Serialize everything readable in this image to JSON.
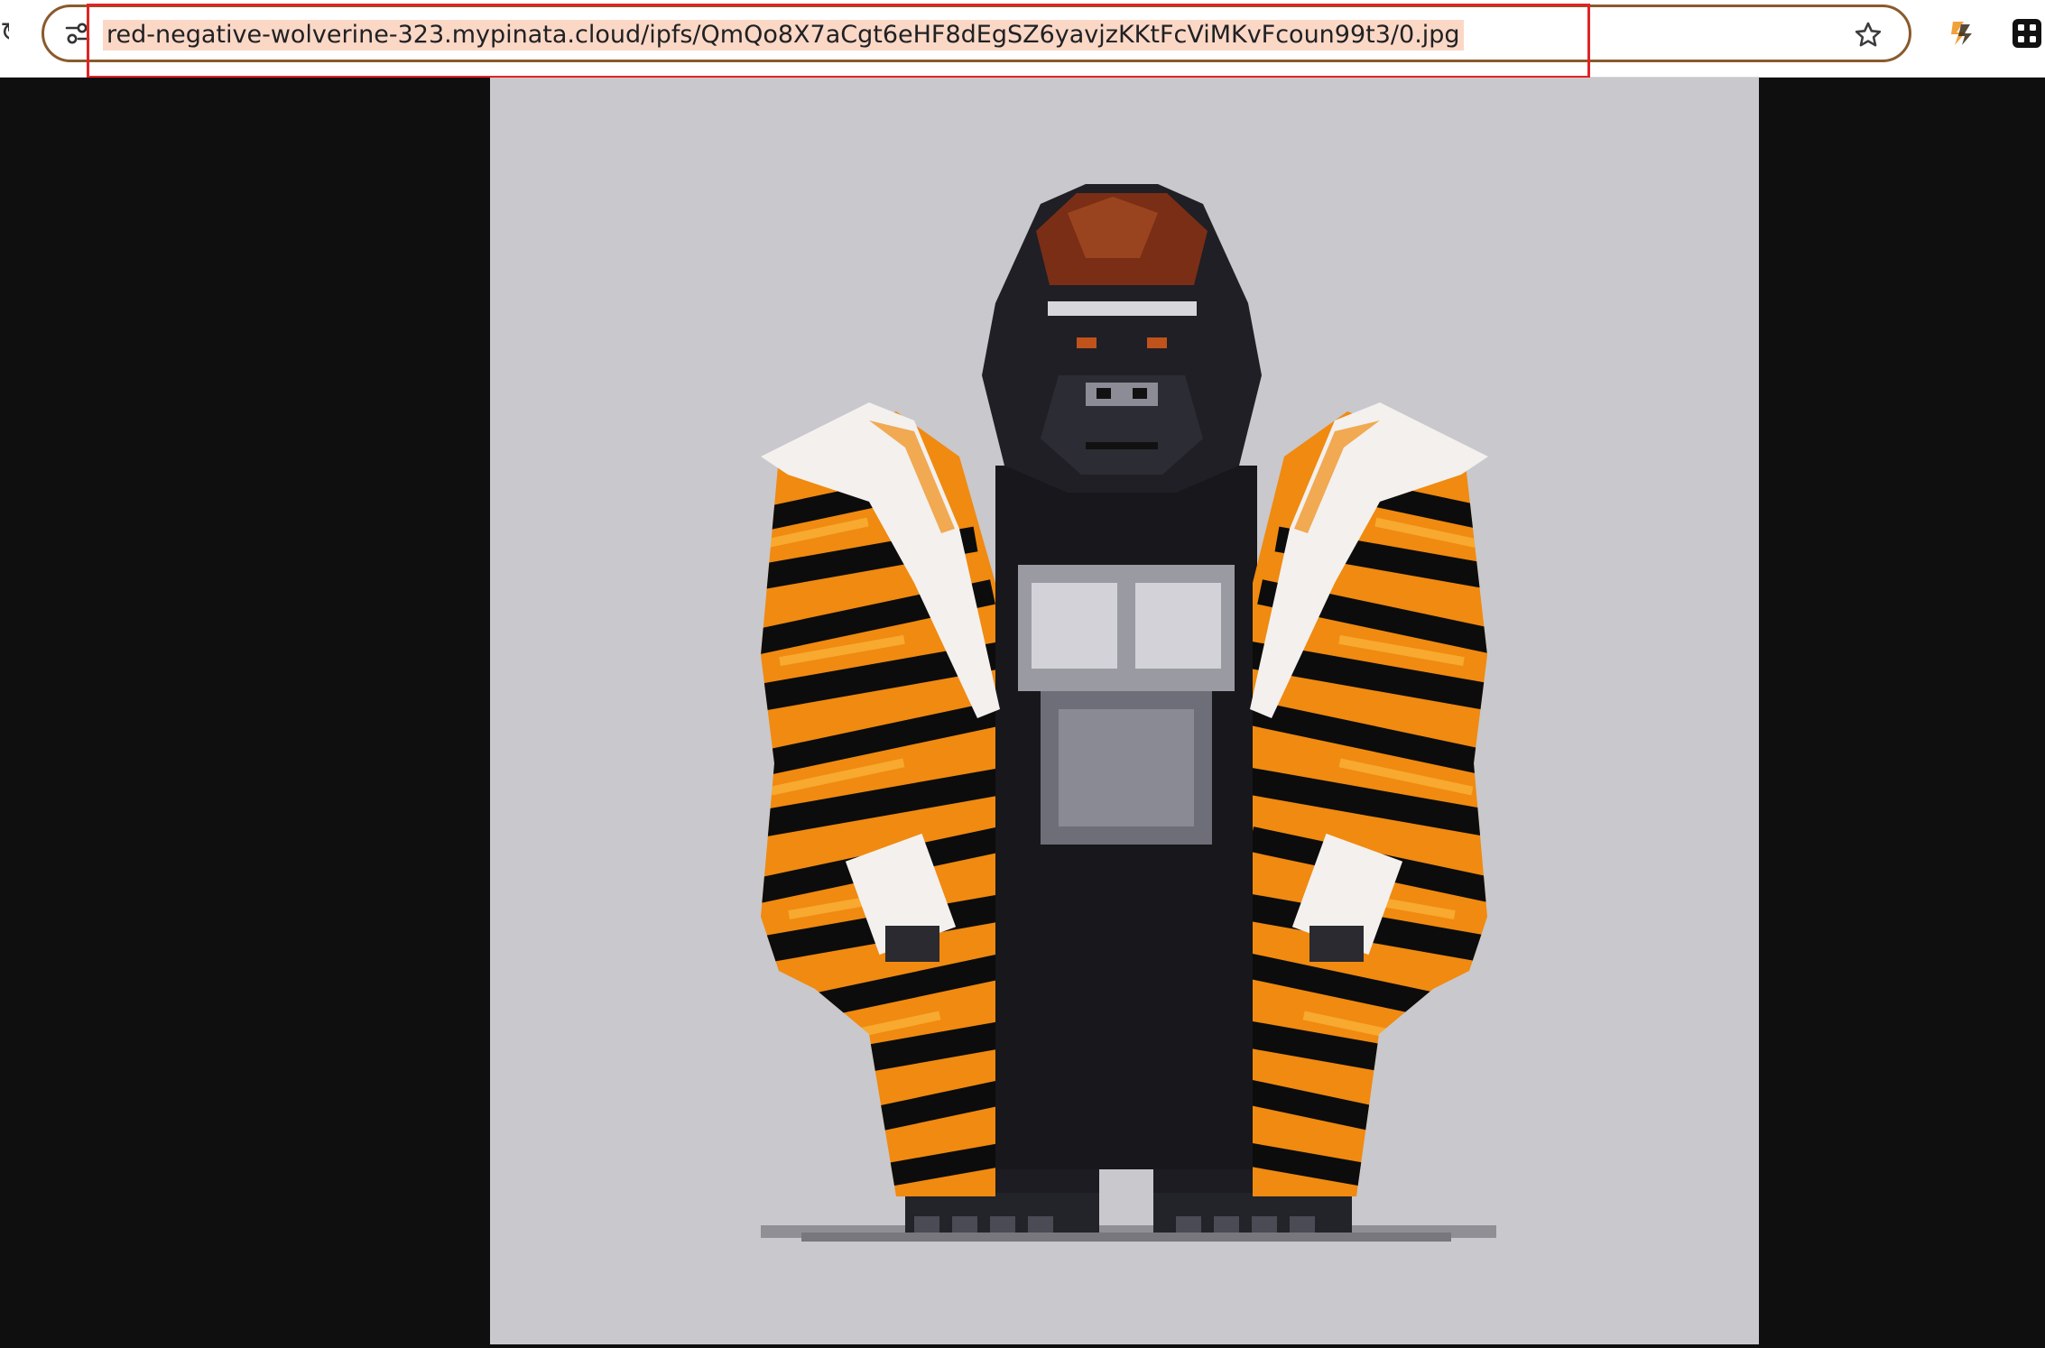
{
  "browser": {
    "address_bar": {
      "url": "red-negative-wolverine-323.mypinata.cloud/ipfs/QmQo8X7aCgt6eHF8dEgSZ6yavjzKKtFcViMKvFcoun99t3/0.jpg",
      "selected": true,
      "highlight_color": "#fbd8c6"
    },
    "annotation": {
      "color": "#e02424",
      "target": "address-bar-url"
    },
    "icons": {
      "site_info": "tune-icon",
      "bookmark": "star-outline-icon",
      "extension_1": "orange-extension-icon",
      "extension_2": "black-grid-extension-icon"
    }
  },
  "content": {
    "image_subject": "pixel-art-gorilla-in-tiger-fur-coat",
    "background_color": "#c9c8cc",
    "page_background_color": "#0f0f0f"
  }
}
